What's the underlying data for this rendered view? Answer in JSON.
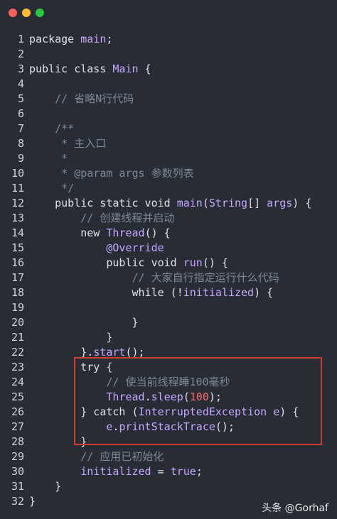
{
  "code": {
    "lines": [
      {
        "n": "1",
        "segments": [
          {
            "t": "package ",
            "c": "kw"
          },
          {
            "t": "main",
            "c": "ty"
          },
          {
            "t": ";",
            "c": "kw"
          }
        ]
      },
      {
        "n": "2",
        "segments": []
      },
      {
        "n": "3",
        "segments": [
          {
            "t": "public class ",
            "c": "kw"
          },
          {
            "t": "Main",
            "c": "ty"
          },
          {
            "t": " {",
            "c": "kw"
          }
        ]
      },
      {
        "n": "4",
        "segments": []
      },
      {
        "n": "5",
        "segments": [
          {
            "t": "    // 省略N行代码",
            "c": "cm"
          }
        ]
      },
      {
        "n": "6",
        "segments": []
      },
      {
        "n": "7",
        "segments": [
          {
            "t": "    /**",
            "c": "cm"
          }
        ]
      },
      {
        "n": "8",
        "segments": [
          {
            "t": "     * 主入口",
            "c": "cm"
          }
        ]
      },
      {
        "n": "9",
        "segments": [
          {
            "t": "     *",
            "c": "cm"
          }
        ]
      },
      {
        "n": "10",
        "segments": [
          {
            "t": "     * @param args 参数列表",
            "c": "cm"
          }
        ]
      },
      {
        "n": "11",
        "segments": [
          {
            "t": "     */",
            "c": "cm"
          }
        ]
      },
      {
        "n": "12",
        "segments": [
          {
            "t": "    public static void ",
            "c": "kw"
          },
          {
            "t": "main",
            "c": "fn"
          },
          {
            "t": "(",
            "c": "kw"
          },
          {
            "t": "String",
            "c": "ty"
          },
          {
            "t": "[] ",
            "c": "kw"
          },
          {
            "t": "args",
            "c": "ty"
          },
          {
            "t": ") {",
            "c": "kw"
          }
        ]
      },
      {
        "n": "13",
        "segments": [
          {
            "t": "        // 创建线程并启动",
            "c": "cm"
          }
        ]
      },
      {
        "n": "14",
        "segments": [
          {
            "t": "        new ",
            "c": "kw"
          },
          {
            "t": "Thread",
            "c": "ty"
          },
          {
            "t": "() {",
            "c": "kw"
          }
        ]
      },
      {
        "n": "15",
        "segments": [
          {
            "t": "            ",
            "c": "kw"
          },
          {
            "t": "@Override",
            "c": "ann"
          }
        ]
      },
      {
        "n": "16",
        "segments": [
          {
            "t": "            public void ",
            "c": "kw"
          },
          {
            "t": "run",
            "c": "fn"
          },
          {
            "t": "() {",
            "c": "kw"
          }
        ]
      },
      {
        "n": "17",
        "segments": [
          {
            "t": "                // 大家自行指定运行什么代码",
            "c": "cm"
          }
        ]
      },
      {
        "n": "18",
        "segments": [
          {
            "t": "                while (!",
            "c": "kw"
          },
          {
            "t": "initialized",
            "c": "ty"
          },
          {
            "t": ") {",
            "c": "kw"
          }
        ]
      },
      {
        "n": "19",
        "segments": []
      },
      {
        "n": "20",
        "segments": [
          {
            "t": "                }",
            "c": "kw"
          }
        ]
      },
      {
        "n": "21",
        "segments": [
          {
            "t": "            }",
            "c": "kw"
          }
        ]
      },
      {
        "n": "22",
        "segments": [
          {
            "t": "        }.",
            "c": "kw"
          },
          {
            "t": "start",
            "c": "fn"
          },
          {
            "t": "();",
            "c": "kw"
          }
        ]
      },
      {
        "n": "23",
        "segments": [
          {
            "t": "        try {",
            "c": "kw"
          }
        ]
      },
      {
        "n": "24",
        "segments": [
          {
            "t": "            // 使当前线程睡100毫秒",
            "c": "cm"
          }
        ]
      },
      {
        "n": "25",
        "segments": [
          {
            "t": "            ",
            "c": "kw"
          },
          {
            "t": "Thread",
            "c": "ty"
          },
          {
            "t": ".",
            "c": "kw"
          },
          {
            "t": "sleep",
            "c": "fn"
          },
          {
            "t": "(",
            "c": "kw"
          },
          {
            "t": "100",
            "c": "num"
          },
          {
            "t": ");",
            "c": "kw"
          }
        ]
      },
      {
        "n": "26",
        "segments": [
          {
            "t": "        } catch (",
            "c": "kw"
          },
          {
            "t": "InterruptedException",
            "c": "ty"
          },
          {
            "t": " ",
            "c": "kw"
          },
          {
            "t": "e",
            "c": "ty"
          },
          {
            "t": ") {",
            "c": "kw"
          }
        ]
      },
      {
        "n": "27",
        "segments": [
          {
            "t": "            ",
            "c": "kw"
          },
          {
            "t": "e",
            "c": "ty"
          },
          {
            "t": ".",
            "c": "kw"
          },
          {
            "t": "printStackTrace",
            "c": "fn"
          },
          {
            "t": "();",
            "c": "kw"
          }
        ]
      },
      {
        "n": "28",
        "segments": [
          {
            "t": "        }",
            "c": "kw"
          }
        ]
      },
      {
        "n": "29",
        "segments": [
          {
            "t": "        // 应用已初始化",
            "c": "cm"
          }
        ]
      },
      {
        "n": "30",
        "segments": [
          {
            "t": "        ",
            "c": "kw"
          },
          {
            "t": "initialized",
            "c": "ty"
          },
          {
            "t": " = ",
            "c": "kw"
          },
          {
            "t": "true",
            "c": "ty"
          },
          {
            "t": ";",
            "c": "kw"
          }
        ]
      },
      {
        "n": "31",
        "segments": [
          {
            "t": "    }",
            "c": "kw"
          }
        ]
      },
      {
        "n": "32",
        "segments": [
          {
            "t": "}",
            "c": "kw"
          }
        ]
      }
    ]
  },
  "colors": {
    "background": "#282c34",
    "highlight_border": "#d63a2f"
  },
  "watermark": {
    "text": "头条 @Gorhaf"
  }
}
